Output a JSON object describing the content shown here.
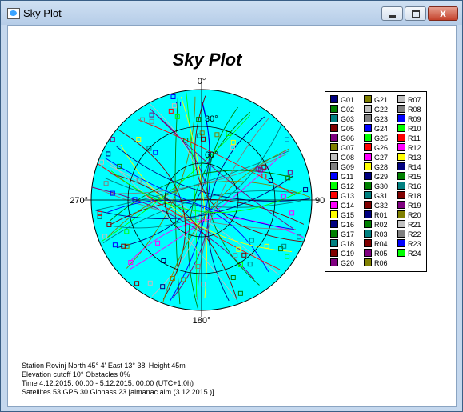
{
  "window": {
    "title": "Sky Plot",
    "close_glyph": "x"
  },
  "plot": {
    "title": "Sky Plot",
    "label_top": "0°",
    "label_bottom": "180°",
    "label_left": "270°",
    "label_right": "90°",
    "ring_30": "30°",
    "ring_60": "60°",
    "sky_color": "#00ffff"
  },
  "legend": [
    {
      "id": "G01",
      "color": "#000080"
    },
    {
      "id": "G02",
      "color": "#008000"
    },
    {
      "id": "G03",
      "color": "#008080"
    },
    {
      "id": "G05",
      "color": "#800000"
    },
    {
      "id": "G06",
      "color": "#800080"
    },
    {
      "id": "G07",
      "color": "#808000"
    },
    {
      "id": "G08",
      "color": "#c0c0c0"
    },
    {
      "id": "G09",
      "color": "#808080"
    },
    {
      "id": "G11",
      "color": "#0000ff"
    },
    {
      "id": "G12",
      "color": "#00ff00"
    },
    {
      "id": "G13",
      "color": "#ff0000"
    },
    {
      "id": "G14",
      "color": "#ff00ff"
    },
    {
      "id": "G15",
      "color": "#ffff00"
    },
    {
      "id": "G16",
      "color": "#000080"
    },
    {
      "id": "G17",
      "color": "#008000"
    },
    {
      "id": "G18",
      "color": "#008080"
    },
    {
      "id": "G19",
      "color": "#800000"
    },
    {
      "id": "G20",
      "color": "#800080"
    },
    {
      "id": "G21",
      "color": "#808000"
    },
    {
      "id": "G22",
      "color": "#c0c0c0"
    },
    {
      "id": "G23",
      "color": "#808080"
    },
    {
      "id": "G24",
      "color": "#0000ff"
    },
    {
      "id": "G25",
      "color": "#00ff00"
    },
    {
      "id": "G26",
      "color": "#ff0000"
    },
    {
      "id": "G27",
      "color": "#ff00ff"
    },
    {
      "id": "G28",
      "color": "#ffff00"
    },
    {
      "id": "G29",
      "color": "#000080"
    },
    {
      "id": "G30",
      "color": "#008000"
    },
    {
      "id": "G31",
      "color": "#008080"
    },
    {
      "id": "G32",
      "color": "#800000"
    },
    {
      "id": "R01",
      "color": "#000080"
    },
    {
      "id": "R02",
      "color": "#008000"
    },
    {
      "id": "R03",
      "color": "#008080"
    },
    {
      "id": "R04",
      "color": "#800000"
    },
    {
      "id": "R05",
      "color": "#800080"
    },
    {
      "id": "R06",
      "color": "#808000"
    },
    {
      "id": "R07",
      "color": "#c0c0c0"
    },
    {
      "id": "R08",
      "color": "#808080"
    },
    {
      "id": "R09",
      "color": "#0000ff"
    },
    {
      "id": "R10",
      "color": "#00ff00"
    },
    {
      "id": "R11",
      "color": "#ff0000"
    },
    {
      "id": "R12",
      "color": "#ff00ff"
    },
    {
      "id": "R13",
      "color": "#ffff00"
    },
    {
      "id": "R14",
      "color": "#000080"
    },
    {
      "id": "R15",
      "color": "#008000"
    },
    {
      "id": "R16",
      "color": "#008080"
    },
    {
      "id": "R18",
      "color": "#800000"
    },
    {
      "id": "R19",
      "color": "#800080"
    },
    {
      "id": "R20",
      "color": "#808000"
    },
    {
      "id": "R21",
      "color": "#c0c0c0"
    },
    {
      "id": "R22",
      "color": "#808080"
    },
    {
      "id": "R23",
      "color": "#0000ff"
    },
    {
      "id": "R24",
      "color": "#00ff00"
    }
  ],
  "info": {
    "line1": "Station Rovinj  North 45° 4'   East 13° 38'   Height 45m",
    "line2": "Elevation cutoff 10°  Obstacles 0%",
    "line3": "Time 4.12.2015. 00:00 -  5.12.2015. 00:00 (UTC+1.0h)",
    "line4": "Satellites 53  GPS 30  Glonass 23  [almanac.alm (3.12.2015.)]"
  }
}
